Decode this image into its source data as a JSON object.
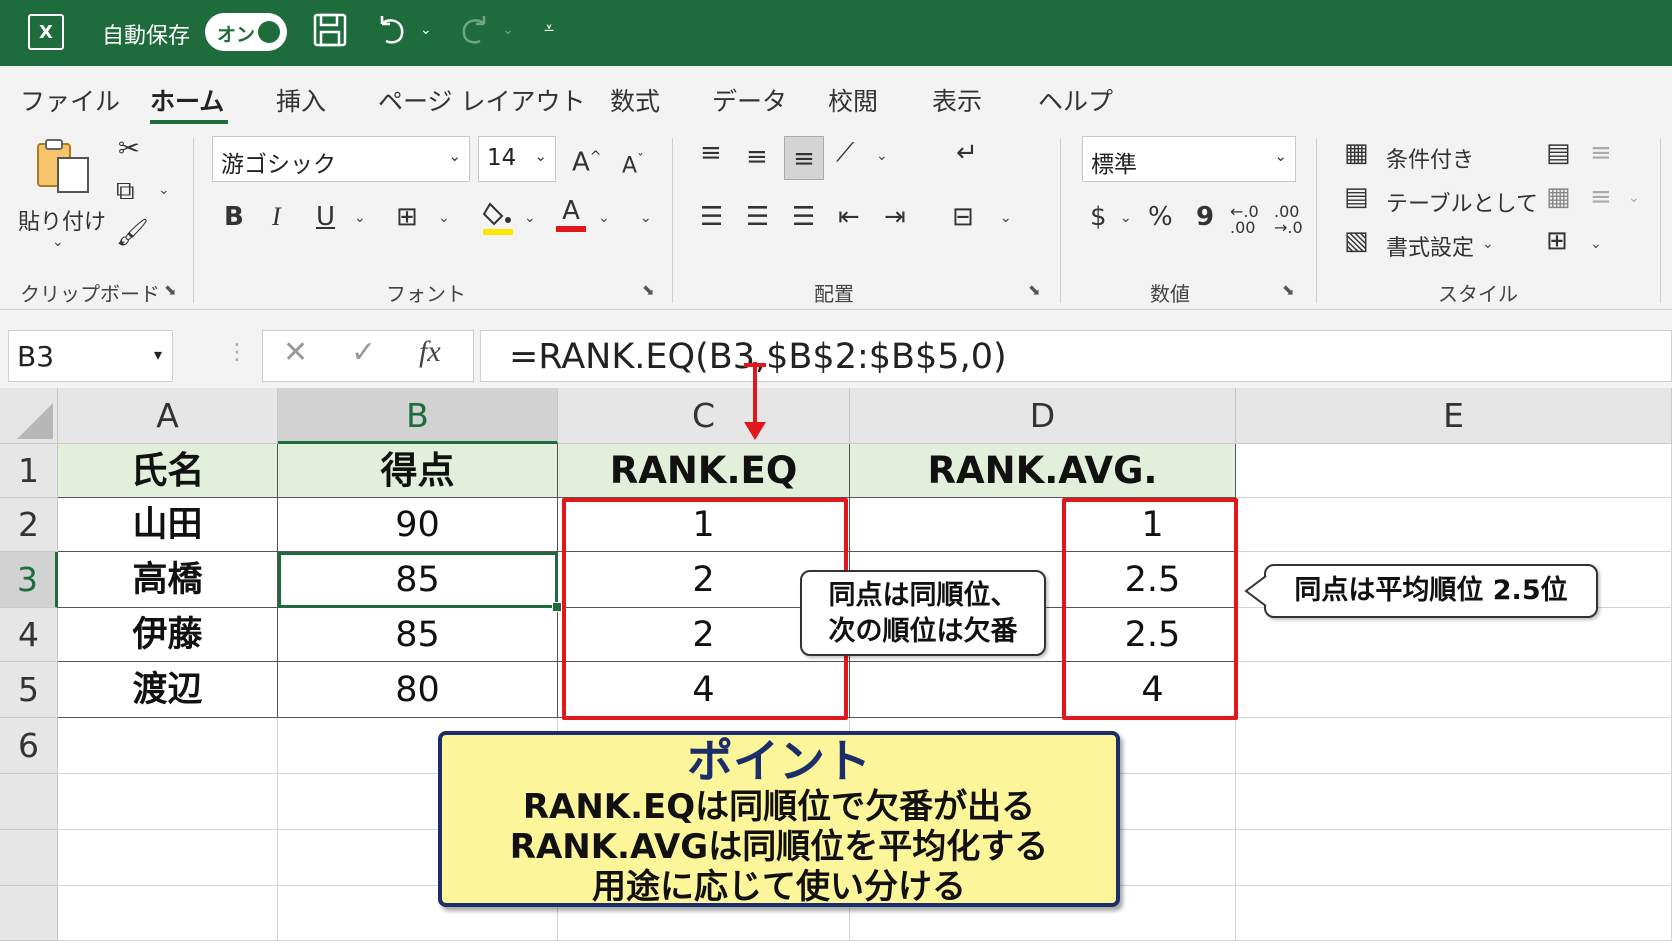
{
  "titlebar": {
    "logo": "X",
    "autosave_label": "自動保存",
    "toggle_label": "オン",
    "icons": [
      "save-icon",
      "undo-icon",
      "redo-icon",
      "customize-icon"
    ]
  },
  "ribbon": {
    "tabs": [
      "ファイル",
      "ホーム",
      "挿入",
      "ページ レイアウト",
      "数式",
      "データ",
      "校閲",
      "表示",
      "ヘルプ"
    ],
    "active_tab": "ホーム",
    "clipboard": {
      "paste_label": "貼り付け",
      "group_label": "クリップボード"
    },
    "font": {
      "font_name": "游ゴシック",
      "font_size": "14",
      "group_label": "フォント",
      "bold": "B",
      "italic": "I",
      "underline": "U",
      "grow": "A",
      "shrink": "A",
      "font_color": "A"
    },
    "alignment": {
      "group_label": "配置"
    },
    "number": {
      "format": "標準",
      "group_label": "数値",
      "currency": "$",
      "percent": "%",
      "comma": "9"
    },
    "styles": {
      "conditional": "条件付き",
      "table": "テーブルとして",
      "cell_styles": "書式設定",
      "group_label": "スタイル"
    }
  },
  "formula_bar": {
    "name_box": "B3",
    "fx": "fx",
    "formula": "=RANK.EQ(B3,$B$2:$B$5,0)"
  },
  "sheet": {
    "columns": [
      "A",
      "B",
      "C",
      "D",
      "E"
    ],
    "rows": [
      "1",
      "2",
      "3",
      "4",
      "5",
      "6"
    ],
    "header": [
      "氏名",
      "得点",
      "RANK.EQ",
      "RANK.AVG."
    ],
    "data": [
      [
        "山田",
        "90",
        "1",
        "1"
      ],
      [
        "高橋",
        "85",
        "2",
        "2.5"
      ],
      [
        "伊藤",
        "85",
        "2",
        "2.5"
      ],
      [
        "渡辺",
        "80",
        "4",
        "4"
      ]
    ],
    "selected_cell": "B3"
  },
  "callouts": {
    "eq_note_line1": "同点は同順位、",
    "eq_note_line2": "次の順位は欠番",
    "avg_note": "同点は平均順位 2.5位"
  },
  "point": {
    "title": "ポイント",
    "lines": [
      "RANK.EQは同順位で欠番が出る",
      "RANK.AVGは同順位を平均化する",
      "用途に応じて使い分ける"
    ]
  },
  "colors": {
    "excel_green": "#1e6b3c",
    "highlight_red": "#e0171b",
    "note_yellow": "#fdf59a",
    "header_fill": "#e2efda"
  }
}
